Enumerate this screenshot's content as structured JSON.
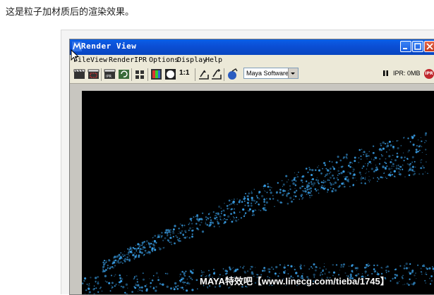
{
  "caption": "这是粒子加材质后的渲染效果。",
  "window": {
    "title": "Render View",
    "minimize_icon": "minimize-icon",
    "maximize_icon": "maximize-icon",
    "close_icon": "close-icon"
  },
  "menu": [
    "File",
    "View",
    "Render",
    "IPR",
    "Options",
    "Display",
    "Help"
  ],
  "toolbar": {
    "icons": [
      "redo-render-icon",
      "render-region-icon",
      "ipr-render-icon",
      "refresh-ipr-icon",
      "snapshot-icon",
      "rgb-channel-icon",
      "alpha-channel-icon",
      "zoom-1-1-icon",
      "keep-image-icon",
      "remove-image-icon",
      "tag-icon"
    ],
    "zoom_label": "1:1",
    "renderer": "Maya Software",
    "ipr_status": "IPR: 0MB",
    "ipr_badge": "IPR"
  },
  "watermark": "MAYA特效吧【www.linecg.com/tieba/1745】",
  "colors": {
    "titlebar": "#0b4fd6",
    "particle": "#3aa0e8",
    "canvas": "#000000"
  }
}
